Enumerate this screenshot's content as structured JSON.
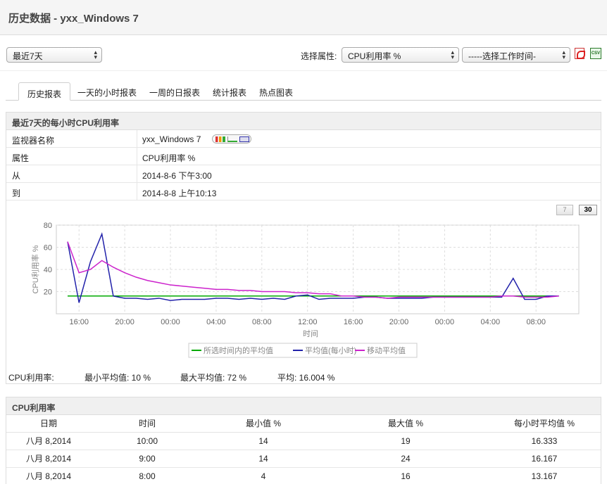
{
  "page": {
    "title": "历史数据 - yxx_Windows 7"
  },
  "toolbar": {
    "period_value": "最近7天",
    "prop_label": "选择属性:",
    "attribute_value": "CPU利用率 %",
    "worktime_value": "-----选择工作时间-",
    "pdf_icon": "pdf-icon",
    "csv_icon": "csv-icon",
    "csv_text": "CSV"
  },
  "tabs": [
    "历史报表",
    "一天的小时报表",
    "一周的日报表",
    "统计报表",
    "热点图表"
  ],
  "report": {
    "header": "最近7天的每小时CPU利用率",
    "rows": [
      {
        "key": "监视器名称",
        "value": "yxx_Windows 7"
      },
      {
        "key": "属性",
        "value": "CPU利用率 %"
      },
      {
        "key": "从",
        "value": "2014-8-6 下午3:00"
      },
      {
        "key": "到",
        "value": "2014-8-8 上午10:13"
      }
    ],
    "btn7": "7",
    "btn30": "30"
  },
  "summary": {
    "label": "CPU利用率:",
    "min_avg": "最小平均值: 10 %",
    "max_avg": "最大平均值: 72 %",
    "avg": "平均: 16.004 %"
  },
  "table": {
    "header": "CPU利用率",
    "columns": [
      "日期",
      "时间",
      "最小值 %",
      "最大值 %",
      "每小时平均值 %"
    ],
    "rows": [
      [
        "八月 8,2014",
        "10:00",
        "14",
        "19",
        "16.333"
      ],
      [
        "八月 8,2014",
        "9:00",
        "14",
        "24",
        "16.167"
      ],
      [
        "八月 8,2014",
        "8:00",
        "4",
        "16",
        "13.167"
      ]
    ]
  },
  "colors": {
    "avg_all": "#00aa00",
    "hourly": "#2222aa",
    "moving": "#cc22cc"
  },
  "chart_data": {
    "type": "line",
    "xlabel": "时间",
    "ylabel": "CPU利用率 %",
    "ylim": [
      0,
      80
    ],
    "yticks": [
      20,
      40,
      60,
      80
    ],
    "xtick_labels": [
      "16:00",
      "20:00",
      "00:00",
      "04:00",
      "08:00",
      "12:00",
      "16:00",
      "20:00",
      "00:00",
      "04:00",
      "08:00"
    ],
    "xtick_hours": [
      1,
      5,
      9,
      13,
      17,
      21,
      25,
      29,
      33,
      37,
      41
    ],
    "grid": true,
    "legend_position": "bottom",
    "x_hours_since_start": [
      0,
      1,
      2,
      3,
      4,
      5,
      6,
      7,
      8,
      9,
      10,
      11,
      12,
      13,
      14,
      15,
      16,
      17,
      18,
      19,
      20,
      21,
      22,
      23,
      24,
      25,
      26,
      27,
      28,
      29,
      30,
      31,
      32,
      33,
      34,
      35,
      36,
      37,
      38,
      39,
      40,
      41,
      42,
      43
    ],
    "series": [
      {
        "name": "所选时间内的平均值",
        "color": "#00aa00",
        "values": [
          16,
          16,
          16,
          16,
          16,
          16,
          16,
          16,
          16,
          16,
          16,
          16,
          16,
          16,
          16,
          16,
          16,
          16,
          16,
          16,
          16,
          16,
          16,
          16,
          16,
          16,
          16,
          16,
          16,
          16,
          16,
          16,
          16,
          16,
          16,
          16,
          16,
          16,
          16,
          16,
          16,
          16,
          16,
          16
        ]
      },
      {
        "name": "平均值(每小时)",
        "color": "#2222aa",
        "values": [
          65,
          10,
          47,
          72,
          16,
          14,
          14,
          13,
          14,
          12,
          13,
          13,
          13,
          14,
          14,
          13,
          14,
          13,
          14,
          13,
          16,
          17,
          13,
          14,
          14,
          14,
          15,
          15,
          14,
          14,
          14,
          14,
          15,
          15,
          15,
          15,
          15,
          15,
          15,
          32,
          13,
          13,
          16,
          16
        ]
      },
      {
        "name": "移动平均值",
        "color": "#cc22cc",
        "values": [
          65,
          37,
          40,
          48,
          42,
          37,
          33,
          30,
          28,
          26,
          25,
          24,
          23,
          22,
          22,
          21,
          21,
          20,
          20,
          20,
          19,
          19,
          18,
          18,
          16,
          16,
          15,
          15,
          14,
          15,
          15,
          15,
          15,
          15,
          15,
          15,
          15,
          15,
          16,
          16,
          15,
          15,
          15,
          16
        ]
      }
    ]
  }
}
